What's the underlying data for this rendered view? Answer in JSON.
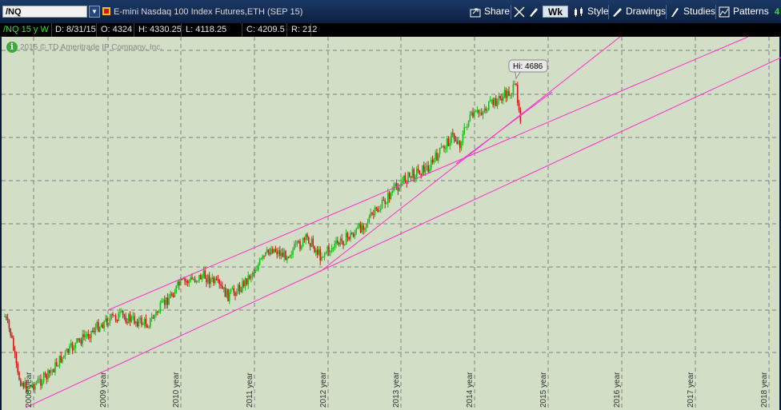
{
  "header": {
    "symbol": "/NQ",
    "description": "E-mini Nasdaq 100 Index Futures,ETH (SEP 15)",
    "corner": "4",
    "buttons": {
      "share": "Share",
      "period": "Wk",
      "style": "Style",
      "drawings": "Drawings",
      "studies": "Studies",
      "patterns": "Patterns"
    }
  },
  "quote": {
    "study": "/NQ 15 y W",
    "date": "D: 8/31/15",
    "open": "O: 4324",
    "high": "H: 4330.25",
    "low": "L: 4118.25",
    "close": "C: 4209.5",
    "range": "R: 212"
  },
  "chart": {
    "copyright": "2015 © TD Ameritrade IP Company, Inc.",
    "hi_label": "Hi: 4686",
    "colors": {
      "background": "#d2dfc6",
      "up": "#16c016",
      "down": "#d01818",
      "trendline": "#ff2ccf",
      "grid": "#808080"
    }
  },
  "chart_data": {
    "type": "candlestick",
    "x_ticks": [
      "2008 year",
      "2009 year",
      "2010 year",
      "2011 year",
      "2012 year",
      "2013 year",
      "2014 year",
      "2015 year",
      "2016 year",
      "2017 year",
      "2018 year"
    ],
    "annotation": "Hi: 4686",
    "grid": true,
    "trendlines": 4
  }
}
